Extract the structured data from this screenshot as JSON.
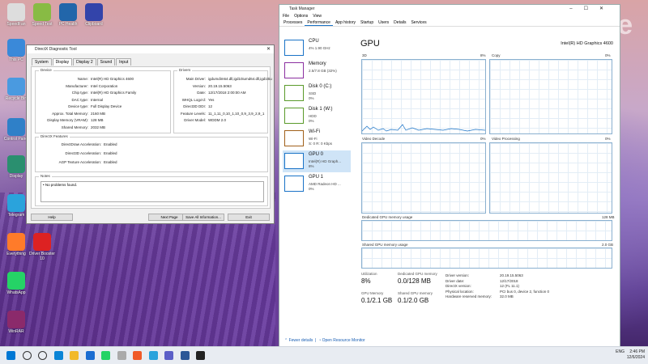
{
  "desktop_icons": [
    {
      "label": "SpeedFan",
      "color": "#dddddd"
    },
    {
      "label": "Speed Test",
      "color": "#88bb44"
    },
    {
      "label": "PC Health",
      "color": "#2266aa"
    },
    {
      "label": "Clipboard",
      "color": "#3344aa"
    },
    {
      "label": "This PC",
      "color": "#3a89d9"
    },
    {
      "label": "Recycle Bin",
      "color": "#4a9ae0"
    },
    {
      "label": "Control Panel",
      "color": "#2f80c8"
    },
    {
      "label": "Display",
      "color": "#2a8f6f"
    },
    {
      "label": "Telegram",
      "color": "#2aa3dc"
    },
    {
      "label": "Everything",
      "color": "#ff7b2a"
    },
    {
      "label": "Driver Booster 10",
      "color": "#d22"
    },
    {
      "label": "WhatsApp",
      "color": "#25d366"
    },
    {
      "label": "WinRAR",
      "color": "#8b2a6b"
    }
  ],
  "dxdiag": {
    "title": "DirectX Diagnostic Tool",
    "tabs": [
      "System",
      "Display",
      "Display 2",
      "Sound",
      "Input"
    ],
    "active_tab": 1,
    "device_title": "Device",
    "device_rows": [
      {
        "k": "Name:",
        "v": "Intel(R) HD Graphics 4600"
      },
      {
        "k": "Manufacturer:",
        "v": "Intel Corporation"
      },
      {
        "k": "Chip type:",
        "v": "Intel(R) HD Graphics Family"
      },
      {
        "k": "DAC type:",
        "v": "Internal"
      },
      {
        "k": "Device type:",
        "v": "Full Display Device"
      },
      {
        "k": "Approx. Total Memory:",
        "v": "2160 MB"
      },
      {
        "k": "Display Memory (VRAM):",
        "v": "128 MB"
      },
      {
        "k": "Shared Memory:",
        "v": "2032 MB"
      }
    ],
    "drivers_title": "Drivers",
    "driver_rows": [
      {
        "k": "Main Driver:",
        "v": "igdumdim64.dll,igd10iumd64.dll,igd10iu"
      },
      {
        "k": "Version:",
        "v": "20.19.15.5063"
      },
      {
        "k": "Date:",
        "v": "12/17/2018 2:00:00 AM"
      },
      {
        "k": "WHQL Logo'd:",
        "v": "Yes"
      },
      {
        "k": "Direct3D DDI:",
        "v": "12"
      },
      {
        "k": "Feature Levels:",
        "v": "11_1,11_0,10_1,10_0,9_3,9_2,9_1"
      },
      {
        "k": "Driver Model:",
        "v": "WDDM 2.0"
      }
    ],
    "features_title": "DirectX Features",
    "feature_rows": [
      {
        "k": "DirectDraw Acceleration:",
        "v": "Enabled"
      },
      {
        "k": "Direct3D Acceleration:",
        "v": "Enabled"
      },
      {
        "k": "AGP Texture Acceleration:",
        "v": "Enabled"
      }
    ],
    "notes_title": "Notes",
    "notes": "No problems found.",
    "buttons": {
      "help": "Help",
      "next": "Next Page",
      "save": "Save All Information...",
      "exit": "Exit"
    }
  },
  "taskmgr": {
    "title": "Task Manager",
    "menu": [
      "File",
      "Options",
      "View"
    ],
    "tabs": [
      "Processes",
      "Performance",
      "App history",
      "Startup",
      "Users",
      "Details",
      "Services"
    ],
    "active_tab": 1,
    "side": [
      {
        "name": "CPU",
        "sub1": "4% 1.90 GHz",
        "sub2": "",
        "color": "#1a73c7"
      },
      {
        "name": "Memory",
        "sub1": "2.5/7.8 GB (32%)",
        "sub2": "",
        "color": "#8b2fa0"
      },
      {
        "name": "Disk 0 (C:)",
        "sub1": "SSD",
        "sub2": "0%",
        "color": "#5a9a2a"
      },
      {
        "name": "Disk 1 (W:)",
        "sub1": "HDD",
        "sub2": "0%",
        "color": "#5a9a2a"
      },
      {
        "name": "Wi-Fi",
        "sub1": "Wi-Fi",
        "sub2": "S: 0 R: 0 Kbps",
        "color": "#a0601a"
      },
      {
        "name": "GPU 0",
        "sub1": "Intel(R) HD Graph...",
        "sub2": "8%",
        "color": "#1a73c7"
      },
      {
        "name": "GPU 1",
        "sub1": "AMD Radeon HD ...",
        "sub2": "0%",
        "color": "#1a73c7"
      }
    ],
    "active_side": 5,
    "heading": "GPU",
    "gpu_name": "Intel(R) HD Graphics 4600",
    "graph_labels": {
      "g1": "3D",
      "g1p": "8%",
      "g2": "Copy",
      "g2p": "0%",
      "g3": "Video Decode",
      "g3p": "0%",
      "g4": "Video Processing",
      "g4p": "0%",
      "ded": "Dedicated GPU memory usage",
      "ded_max": "128 MB",
      "shared": "Shared GPU memory usage",
      "shared_max": "2.0 GB"
    },
    "stats": [
      {
        "label": "Utilization",
        "value": "8%"
      },
      {
        "label": "Dedicated GPU memory",
        "value": "0.0/128 MB"
      },
      {
        "label": "GPU Memory",
        "value": "0.1/2.1 GB"
      },
      {
        "label": "Shared GPU memory",
        "value": "0.1/2.0 GB"
      }
    ],
    "details": [
      {
        "k": "Driver version:",
        "v": "20.19.15.5063"
      },
      {
        "k": "Driver date:",
        "v": "12/17/2018"
      },
      {
        "k": "DirectX version:",
        "v": "12 (FL 11.1)"
      },
      {
        "k": "Physical location:",
        "v": "PCI bus 0, device 2, function 0"
      },
      {
        "k": "Hardware reserved memory:",
        "v": "32.0 MB"
      }
    ],
    "footer": {
      "fewer": "Fewer details",
      "monitor": "Open Resource Monitor"
    }
  },
  "watermark": "dubizzle",
  "taskbar": {
    "icon_colors": [
      "#0078d4",
      "#333333",
      "#333333",
      "#0a84d6",
      "#f2b92a",
      "#1b6dd1",
      "#25d366",
      "#aaaaaa",
      "#f05a28",
      "#2aa3dc",
      "#5b5fc7",
      "#2b5797",
      "#222222"
    ],
    "tray_label": "ENG",
    "time": "2:46 PM",
    "date": "12/6/2024"
  }
}
